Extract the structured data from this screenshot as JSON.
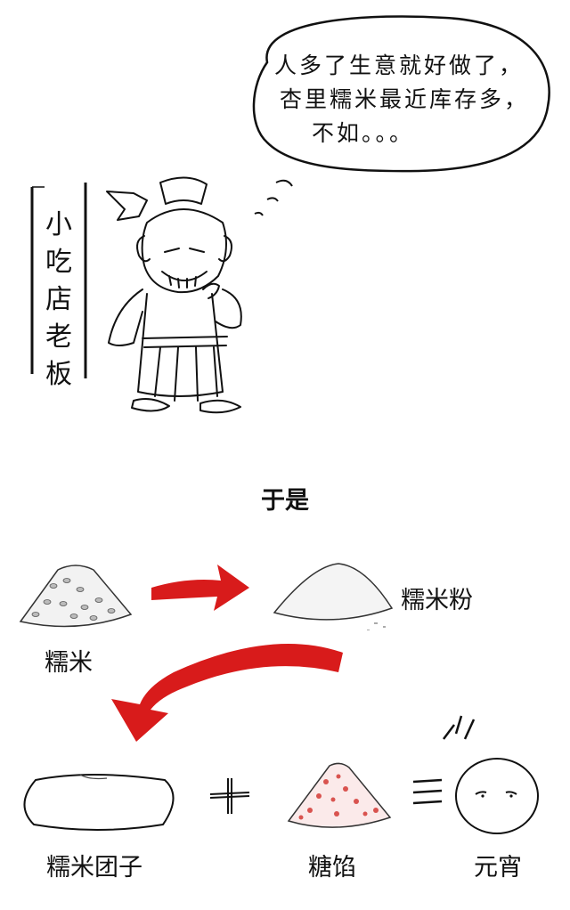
{
  "speech_bubble": {
    "lines": [
      "人多了生意就好做了，",
      "杏里糯米最近库存多，",
      "不如。。。"
    ]
  },
  "side_label": {
    "chars": [
      "小",
      "吃",
      "店",
      "老",
      "板"
    ]
  },
  "transition_text": "于是",
  "process": {
    "rice_label": "糯米",
    "flour_label": "糯米粉",
    "dough_label": "糯米团子",
    "filling_label": "糖馅",
    "result_label": "元宵",
    "plus_symbol": "+",
    "equals_symbol": "="
  },
  "colors": {
    "arrow_red": "#d81b1b",
    "filling_red": "#d9534f",
    "ink": "#111111"
  }
}
